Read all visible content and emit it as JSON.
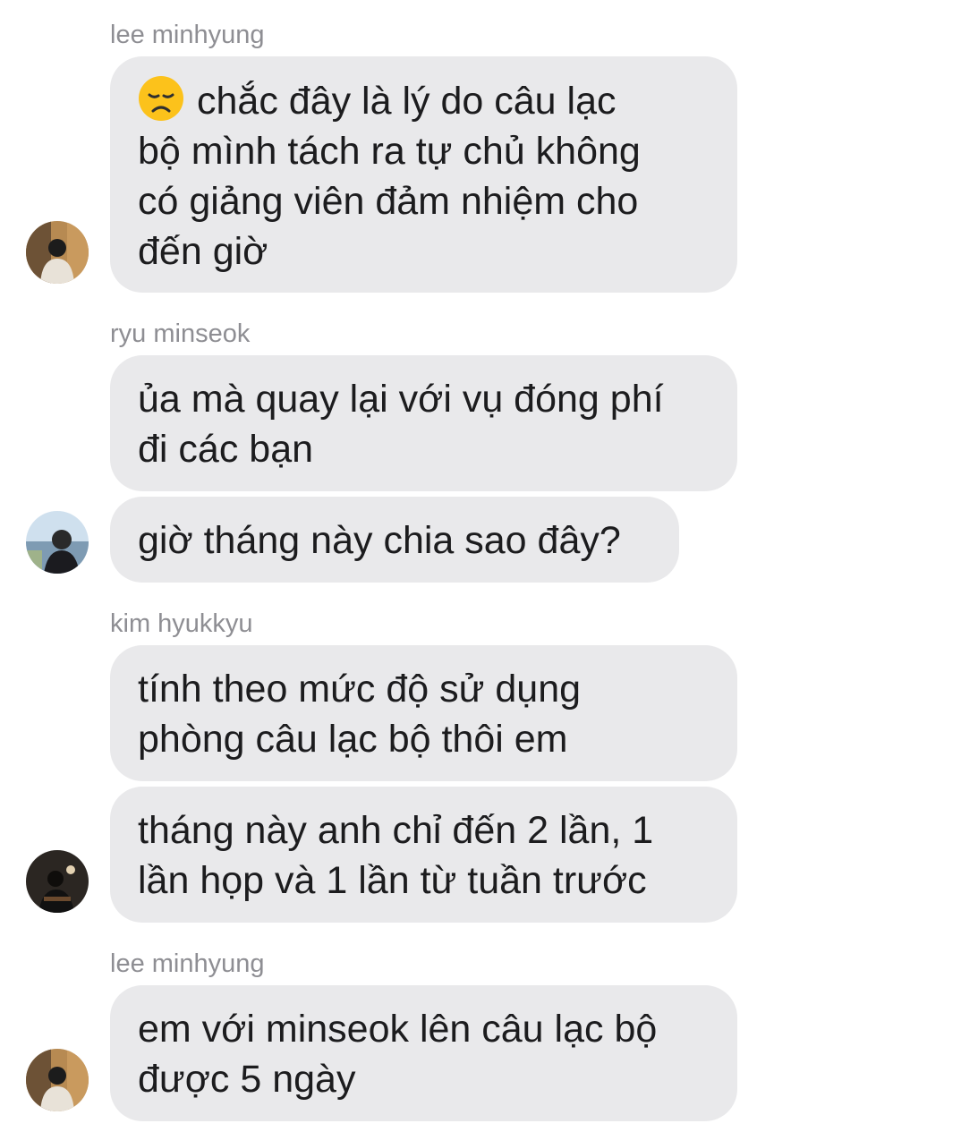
{
  "messages": [
    {
      "sender": "lee minhyung",
      "bubbles": [
        {
          "emoji": "disappointed-face",
          "lines": [
            "chắc đây là lý do câu lạc",
            "bộ mình tách ra tự chủ không",
            "có giảng viên đảm nhiệm cho",
            "đến giờ"
          ]
        }
      ]
    },
    {
      "sender": "ryu minseok",
      "bubbles": [
        {
          "lines": [
            "ủa mà quay lại với vụ đóng phí",
            "đi các bạn"
          ]
        },
        {
          "lines": [
            "giờ tháng này chia sao đây?"
          ]
        }
      ]
    },
    {
      "sender": "kim hyukkyu",
      "bubbles": [
        {
          "lines": [
            "tính theo mức độ sử dụng",
            "phòng câu lạc bộ thôi em"
          ]
        },
        {
          "lines": [
            "tháng này anh chỉ đến 2 lần, 1",
            "lần họp và 1 lần từ tuần trước"
          ]
        }
      ]
    },
    {
      "sender": "lee minhyung",
      "bubbles": [
        {
          "lines": [
            "em với minseok lên câu lạc bộ",
            "được 5 ngày"
          ]
        }
      ]
    }
  ]
}
